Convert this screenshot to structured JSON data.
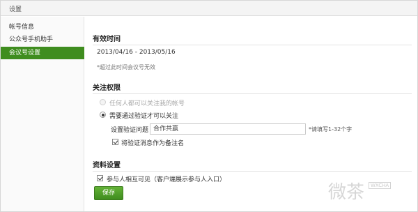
{
  "header": {
    "title": "设置"
  },
  "sidebar": {
    "items": [
      {
        "label": "帐号信息"
      },
      {
        "label": "公众号手机助手"
      },
      {
        "label": "会议号设置"
      }
    ]
  },
  "validity": {
    "title": "有效时间",
    "range": "2013/04/16 - 2013/05/16",
    "note": "*超过此时间会议号无效"
  },
  "follow": {
    "title": "关注权限",
    "option_anyone": "任何人都可以关注我的帐号",
    "option_verify": "需要通过验证才可以关注",
    "question_label": "设置验证问题",
    "question_value": "合作共赢",
    "question_hint": "*请填写1-32个字",
    "use_as_remark": "将验证消息作为备注名"
  },
  "profile": {
    "title": "资料设置",
    "mutual_visible": "参与人相互可见（客户端展示参与人入口）"
  },
  "actions": {
    "save": "保存"
  },
  "watermark": {
    "text": "微茶",
    "sub": "WXCHA"
  }
}
